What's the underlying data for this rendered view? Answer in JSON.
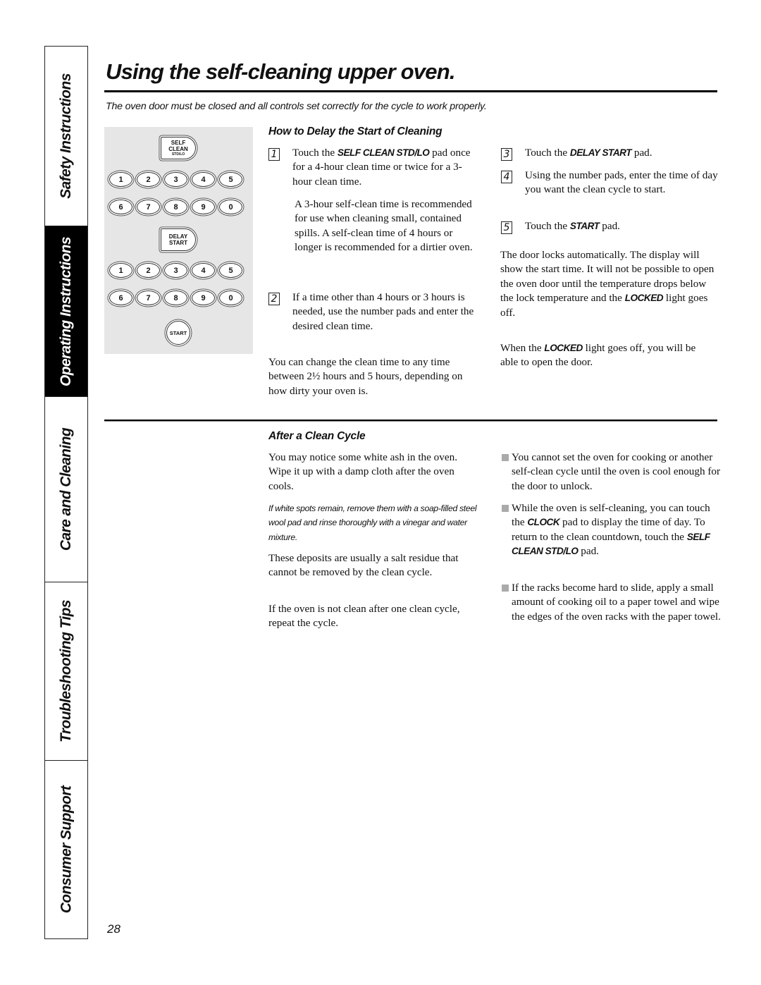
{
  "side_tabs": [
    {
      "label": "Safety Instructions",
      "active": false
    },
    {
      "label": "Operating Instructions",
      "active": true
    },
    {
      "label": "Care and Cleaning",
      "active": false
    },
    {
      "label": "Troubleshooting Tips",
      "active": false
    },
    {
      "label": "Consumer Support",
      "active": false
    }
  ],
  "title": "Using the self-cleaning upper oven.",
  "intro": "The oven door must be closed and all controls set correctly for the cycle to work properly.",
  "keypad": {
    "self_clean": {
      "line1": "SELF",
      "line2": "CLEAN",
      "line3": "STD/LO"
    },
    "delay_start": {
      "line1": "DELAY",
      "line2": "START"
    },
    "row1": [
      "1",
      "2",
      "3",
      "4",
      "5"
    ],
    "row2": [
      "6",
      "7",
      "8",
      "9",
      "0"
    ],
    "start": "START"
  },
  "delay_section": {
    "heading": "How to Delay the Start of Cleaning",
    "steps": [
      {
        "num": "1",
        "pre": "Touch the ",
        "bold": "SELF CLEAN STD/LO",
        "post": " pad once for a 4-hour clean time or twice for a 3-hour clean time."
      },
      {
        "num": "2",
        "text": "If a time other than 4 hours or 3 hours is needed, use the number pads and enter the desired clean time."
      },
      {
        "num": "3",
        "pre": "Touch the ",
        "bold": "DELAY START",
        "post": " pad."
      },
      {
        "num": "4",
        "text": "Using the number pads, enter the time of day you want the clean cycle to start."
      },
      {
        "num": "5",
        "pre": "Touch the ",
        "bold": "START",
        "post": " pad."
      }
    ],
    "step1_note": "A 3-hour self-clean time is recommended for use when cleaning small, contained spills. A self-clean time of 4 hours or longer is recommended for a dirtier oven.",
    "change_note": "You can change the clean time to any time between 2½ hours and 5 hours, depending on how dirty your oven is.",
    "door_locks": {
      "pre": "The door locks automatically. The display will show the start time. It will not be possible to open the oven door until the temperature drops below the lock temperature and the ",
      "bold": "LOCKED",
      "post": " light goes off."
    },
    "when_locked": {
      "pre": "When the ",
      "bold": "LOCKED",
      "post": " light goes off, you will be able to open the door."
    }
  },
  "after_section": {
    "heading": "After a Clean Cycle",
    "para1": "You may notice some white ash in the oven. Wipe it up with a damp cloth after the oven cools.",
    "note": "If white spots remain, remove them with a soap-filled steel wool pad and rinse thoroughly with a vinegar and water mixture.",
    "para2": "These deposits are usually a salt residue that cannot be removed by the clean cycle.",
    "para3": "If the oven is not clean after one clean cycle, repeat the cycle.",
    "bullets": [
      {
        "text": "You cannot set the oven for cooking or another self-clean cycle until the oven is cool enough for the door to unlock."
      },
      {
        "pre": "While the oven is self-cleaning, you can touch the ",
        "bold1": "CLOCK",
        "mid": " pad to display the time of day. To return to the clean countdown, touch the ",
        "bold2": "SELF CLEAN STD/LO",
        "post": " pad."
      },
      {
        "text": "If the racks become hard to slide, apply a small amount of cooking oil to a paper towel and wipe the edges of the oven racks with the paper towel."
      }
    ]
  },
  "page_number": "28"
}
